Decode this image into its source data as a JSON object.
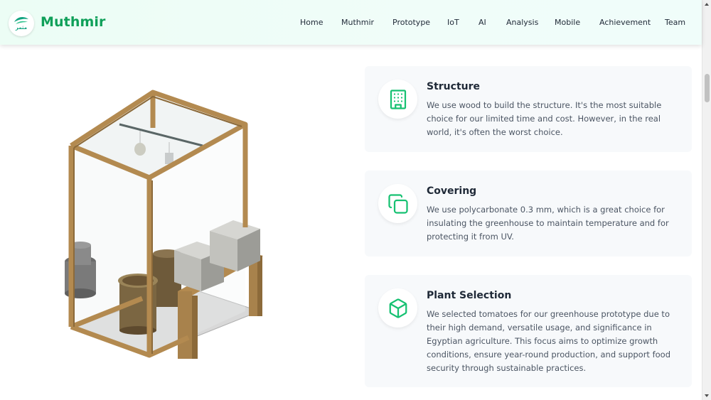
{
  "header": {
    "logo_sub": "مثمر",
    "brand": "Muthmir",
    "nav": [
      {
        "label": "Home"
      },
      {
        "label": "Muthmir"
      },
      {
        "label": "Prototype"
      },
      {
        "label": "IoT"
      },
      {
        "label": "AI"
      },
      {
        "label": "Analysis"
      },
      {
        "label": "Mobile"
      },
      {
        "label": "Achievement"
      },
      {
        "label": "Team"
      }
    ]
  },
  "features": [
    {
      "icon": "building-icon",
      "title": "Structure",
      "text": "We use wood to build the structure. It's the most suitable choice for our limited time and cost. However, in the real world, it's often the worst choice."
    },
    {
      "icon": "copy-squares-icon",
      "title": "Covering",
      "text": "We use polycarbonate 0.3 mm, which is a great choice for insulating the greenhouse to maintain temperature and for protecting it from UV."
    },
    {
      "icon": "cube-icon",
      "title": "Plant Selection",
      "text": "We selected tomatoes for our greenhouse prototype due to their high demand, versatile usage, and significance in Egyptian agriculture. This focus aims to optimize growth conditions, ensure year-round production, and support food security through sustainable practices."
    }
  ],
  "colors": {
    "brand_green": "#10a05a",
    "icon_green": "#16c172",
    "card_bg": "#f7f9fb"
  }
}
